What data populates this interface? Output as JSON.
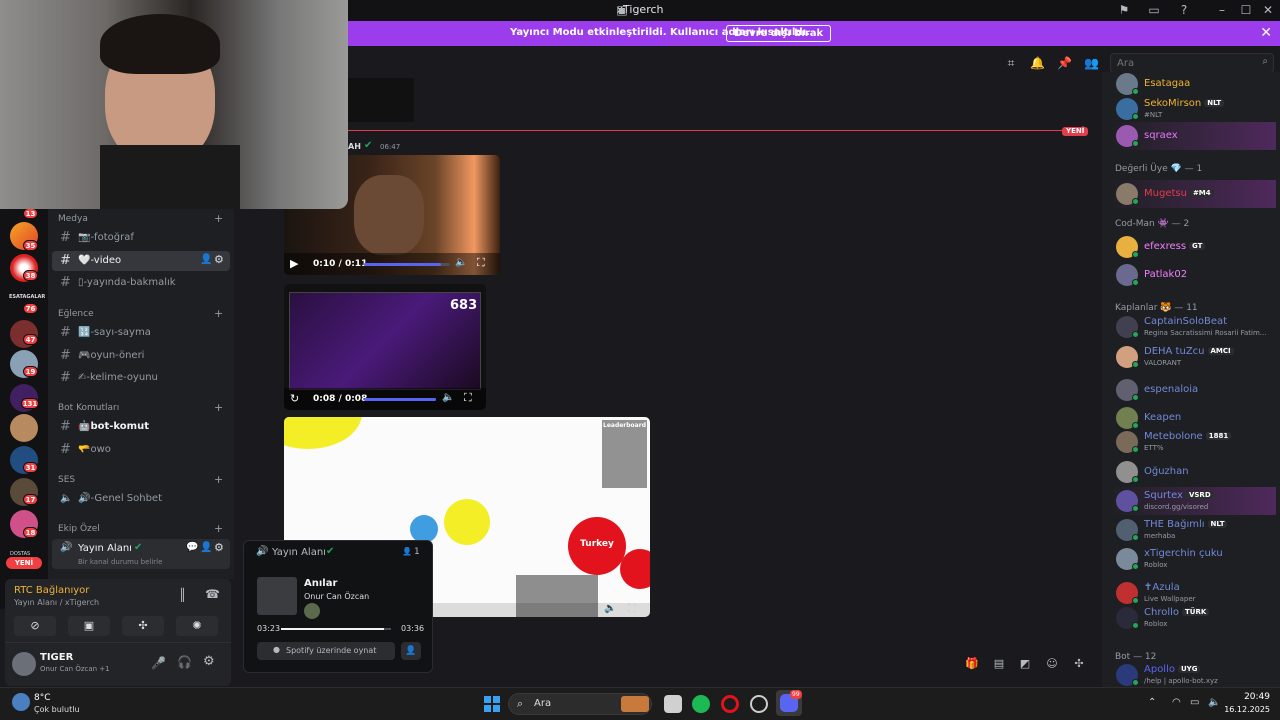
{
  "window": {
    "title": "xTigerch"
  },
  "banner": {
    "message": "Yayıncı Modu etkinleştirildi. Kullanıcı adları kısaltıldı.",
    "button": "Devre dışı bırak"
  },
  "search": {
    "placeholder": "Ara"
  },
  "new_divider": "YENİ",
  "message": {
    "author_fragment": "AH",
    "time": "06:47"
  },
  "videos": [
    {
      "time": "0:10 / 0:11",
      "progress": 0.9
    },
    {
      "time": "0:08 / 0:08",
      "progress": 1.0,
      "counter": "683"
    }
  ],
  "game": {
    "leaderboard_title": "Leaderboard",
    "cell_label": "Turkey"
  },
  "servers": {
    "badges": [
      "13",
      "35",
      "38",
      "76",
      "47",
      "19",
      "131",
      "31",
      "17",
      "18"
    ],
    "new_label": "YENİ",
    "esatagalar": "ESATAGALAR",
    "dostlar": "DOSTAS"
  },
  "categories": [
    {
      "name": "Medya"
    },
    {
      "name": "Eğlence"
    },
    {
      "name": "Bot Komutları"
    },
    {
      "name": "SES"
    },
    {
      "name": "Ekip Özel"
    }
  ],
  "channels": [
    {
      "name": "📷-fotoğraf"
    },
    {
      "name": "🤍-video"
    },
    {
      "name": "▯-yayında-bakmalık"
    },
    {
      "name": "🔢-sayı-sayma"
    },
    {
      "name": "🎮oyun-öneri"
    },
    {
      "name": "✍-kelime-oyunu"
    },
    {
      "name": "🤖bot-komut"
    },
    {
      "name": "🫳owo"
    },
    {
      "name": "🔊-Genel Sohbet"
    }
  ],
  "voice_channel": {
    "name": "Yayın Alanı",
    "status": "Bir kanal durumu belirle"
  },
  "rtc": {
    "status": "RTC Bağlanıyor",
    "location": "Yayın Alanı / xTigerch"
  },
  "user": {
    "name": "TIGER",
    "activity": "Onur Can Özcan +1"
  },
  "popup": {
    "channel": "Yayın Alanı",
    "count": "1",
    "song": "Anılar",
    "artist": "Onur Can Özcan",
    "elapsed": "03:23",
    "total": "03:36",
    "play_label": "Spotify üzerinde oynat",
    "progress": 0.94
  },
  "member_groups": [
    {
      "label": "Değerli Üye 💎 — 1"
    },
    {
      "label": "Cod-Man 👾 — 2"
    },
    {
      "label": "Kaplanlar 🐯 — 11"
    },
    {
      "label": "Bot — 12"
    }
  ],
  "members": [
    {
      "name": "Esatagaa",
      "sub": "",
      "tag": "",
      "color": "#f0b232"
    },
    {
      "name": "SekoMirson",
      "sub": "#NLT",
      "tag": "NLT",
      "color": "#f0b232"
    },
    {
      "name": "sqraex",
      "sub": "",
      "tag": "",
      "color": "#e879f9"
    },
    {
      "name": "Mugetsu",
      "sub": "",
      "tag": "#M4",
      "color": "#e23d4a"
    },
    {
      "name": "efexress",
      "sub": "",
      "tag": "GT",
      "color": "#f47fff"
    },
    {
      "name": "Patlak02",
      "sub": "",
      "tag": "",
      "color": "#f47fff"
    },
    {
      "name": "CaptainSoloBeat",
      "sub": "Regina Sacratissimi Rosarii Fatim...",
      "tag": "",
      "color": "#7289da"
    },
    {
      "name": "DEHA tuZcu",
      "sub": "VALORANT",
      "tag": "AMCI",
      "color": "#7289da"
    },
    {
      "name": "espenaloia",
      "sub": "",
      "tag": "",
      "color": "#7289da"
    },
    {
      "name": "Keapen",
      "sub": "",
      "tag": "",
      "color": "#7289da"
    },
    {
      "name": "Metebolone",
      "sub": "ETT%",
      "tag": "1881",
      "color": "#7289da"
    },
    {
      "name": "Oğuzhan",
      "sub": "",
      "tag": "",
      "color": "#7289da"
    },
    {
      "name": "Squrtex",
      "sub": "discord.gg/visored",
      "tag": "VSRD",
      "color": "#7289da"
    },
    {
      "name": "THE Bağımlı",
      "sub": "merhaba",
      "tag": "NLT",
      "color": "#7289da"
    },
    {
      "name": "xTigerchin çuku",
      "sub": "Roblox",
      "tag": "",
      "color": "#7289da"
    },
    {
      "name": "✝Azula",
      "sub": "Live Wallpaper",
      "tag": "",
      "color": "#7289da"
    },
    {
      "name": "Chrollo",
      "sub": "Roblox",
      "tag": "TÜRK",
      "color": "#7289da"
    },
    {
      "name": "Apollo",
      "sub": "/help | apollo-bot.xyz",
      "tag": "UYG",
      "color": "#5865f2"
    }
  ],
  "taskbar": {
    "weather_temp": "8°C",
    "weather_desc": "Çok bulutlu",
    "search": "Ara",
    "time": "20:49",
    "date": "16.12.2025",
    "discord_badge": "99"
  }
}
